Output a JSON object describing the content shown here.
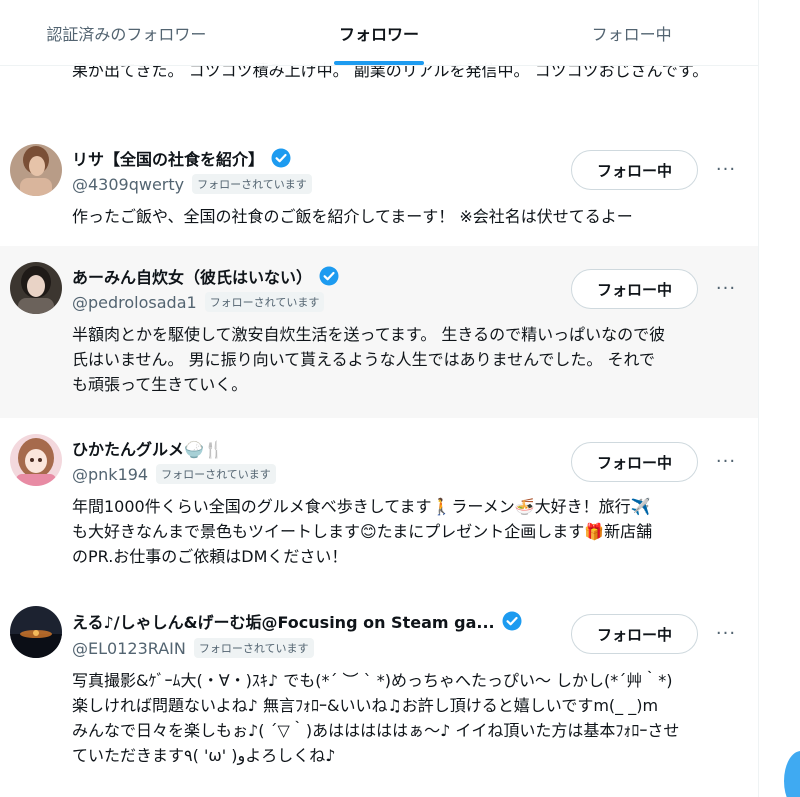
{
  "tabs": [
    {
      "label": "認証済みのフォロワー"
    },
    {
      "label": "フォロワー",
      "active": true
    },
    {
      "label": "フォロー中"
    }
  ],
  "cut_bio": "果が出てきた。 コツコツ積み上げ中。 副業のリアルを発信中。 コツコツおじさんです。",
  "follows_you_label": "フォローされています",
  "follow_button_label": "フォロー中",
  "more_label": "···",
  "users": [
    {
      "name": "リサ【全国の社食を紹介】",
      "handle": "@4309qwerty",
      "verified": true,
      "bio": "作ったご飯や、全国の社食のご飯を紹介してまーす！ ※会社名は伏せてるよー"
    },
    {
      "name": "あーみん自炊女（彼氏はいない）",
      "handle": "@pedrolosada1",
      "verified": true,
      "bio": "半額肉とかを駆使して激安自炊生活を送ってます。 生きるので精いっぱいなので彼\n氏はいません。 男に振り向いて貰えるような人生ではありませんでした。 それで\nも頑張って生きていく。"
    },
    {
      "name": "ひかたんグルメ🍚🍴",
      "handle": "@pnk194",
      "verified": false,
      "bio": "年間1000件くらい全国のグルメ食べ歩きしてます🚶ラーメン🍜大好き！旅行✈️\nも大好きなんまで景色もツイートします😊たまにプレゼント企画します🎁新店舗\nのPR.お仕事のご依頼はDMください！"
    },
    {
      "name": "える♪/しゃしん&げーむ垢@Focusing on Steam ga...",
      "handle": "@EL0123RAIN",
      "verified": true,
      "bio": "写真撮影&ｹﾞｰﾑ大(・∀・)ｽｷ♪ でも(*´ ︶ ` *)めっちゃへたっぴい〜 しかし(*´艸｀*)\n楽しければ問題ないよね♪ 無言ﾌｫﾛｰ&いいね♫お許し頂けると嬉しいですm(_ _)m\nみんなで日々を楽しもぉ♪( ´▽｀)あはははははぁ〜♪ イイね頂いた方は基本ﾌｫﾛｰさせ\nていただきます٩( 'ω' )وよろしくね♪"
    }
  ],
  "colors": {
    "accent": "#1d9bf0",
    "text_primary": "#0f1419",
    "text_secondary": "#536471",
    "row_highlight": "#f7f7f7",
    "border": "#eff3f4"
  }
}
